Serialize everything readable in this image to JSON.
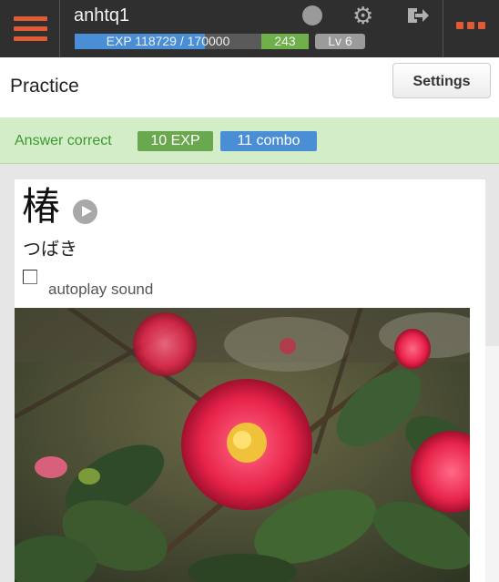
{
  "topbar": {
    "username": "anhtq1",
    "exp_text": "EXP 118729 / 170000",
    "exp_fraction": 0.698,
    "score_badge": "243",
    "level_badge": "Lv 6",
    "icons": [
      "menu-icon",
      "status-dot-icon",
      "gear-icon",
      "logout-icon",
      "more-icon"
    ]
  },
  "header": {
    "title": "Practice",
    "settings_label": "Settings"
  },
  "alert": {
    "text": "Answer correct",
    "exp_badge": "10 EXP",
    "combo_badge": "11 combo"
  },
  "card": {
    "kanji": "椿",
    "reading": "つばき",
    "autoplay_label": "autoplay sound",
    "autoplay_checked": false
  },
  "colors": {
    "topbar_bg": "#2f2f2f",
    "accent_orange": "#e05a33",
    "exp_blue": "#4a8fd6",
    "green": "#6fb04a",
    "alert_bg": "#d4edc9"
  }
}
